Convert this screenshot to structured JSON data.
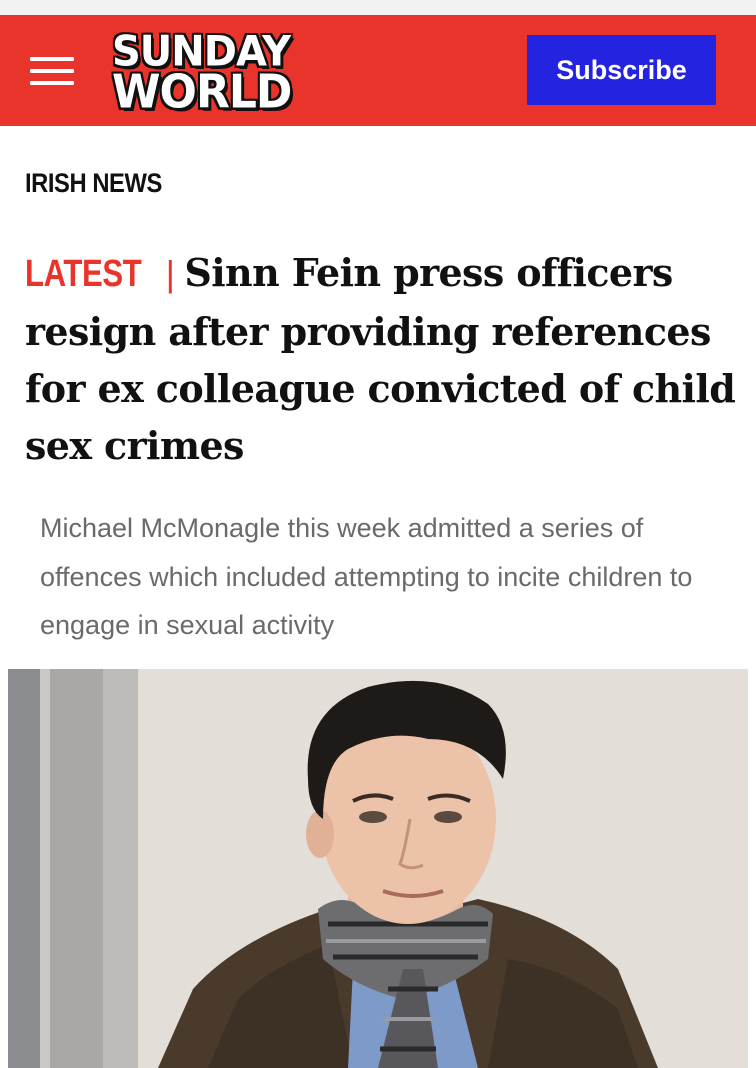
{
  "header": {
    "menu_icon": "hamburger-menu-icon",
    "logo": {
      "line1": "SUNDAY",
      "line2": "WORLD"
    },
    "subscribe_label": "Subscribe",
    "colors": {
      "brand_red": "#e8342a",
      "subscribe_blue": "#2424e0"
    }
  },
  "article": {
    "section": "IRISH NEWS",
    "tag": "LATEST",
    "tag_separator": "|",
    "headline": "Sinn Fein press officers resign after providing references for ex colleague convicted of child sex crimes",
    "standfirst": "Michael McMonagle this week admitted a series of offences which included attempting to incite children to engage in sexual activity"
  },
  "hero_image": {
    "description_icon": "photo-man-in-scarf"
  }
}
